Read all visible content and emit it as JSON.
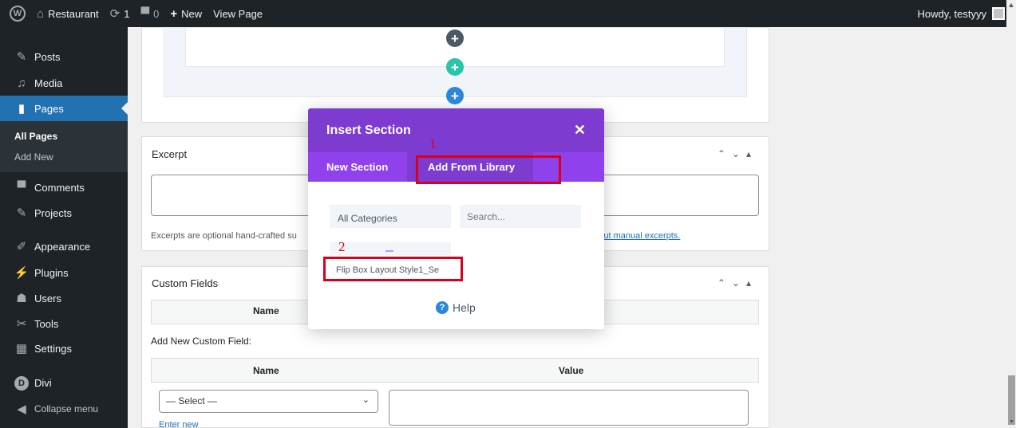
{
  "admin_bar": {
    "site_name": "Restaurant",
    "updates_count": "1",
    "comments_count": "0",
    "new_label": "New",
    "view_page_label": "View Page",
    "greeting": "Howdy, testyyy"
  },
  "sidebar": {
    "items": [
      {
        "label": "Posts",
        "icon": "pin-icon"
      },
      {
        "label": "Media",
        "icon": "media-icon"
      },
      {
        "label": "Pages",
        "icon": "pages-icon"
      },
      {
        "label": "Comments",
        "icon": "comment-icon"
      },
      {
        "label": "Projects",
        "icon": "pin-icon"
      },
      {
        "label": "Appearance",
        "icon": "brush-icon"
      },
      {
        "label": "Plugins",
        "icon": "plugin-icon"
      },
      {
        "label": "Users",
        "icon": "users-icon"
      },
      {
        "label": "Tools",
        "icon": "wrench-icon"
      },
      {
        "label": "Settings",
        "icon": "settings-icon"
      },
      {
        "label": "Divi",
        "icon": "divi-icon"
      },
      {
        "label": "Collapse menu",
        "icon": "collapse-icon"
      }
    ],
    "submenu": {
      "all_pages": "All Pages",
      "add_new": "Add New"
    }
  },
  "excerpt": {
    "title": "Excerpt",
    "help_text": "Excerpts are optional hand-crafted su",
    "link_text": "about manual excerpts."
  },
  "custom_fields": {
    "title": "Custom Fields",
    "name_header": "Name",
    "add_new_label": "Add New Custom Field:",
    "name_header_2": "Name",
    "value_header": "Value",
    "select_value": "— Select —",
    "enter_new": "Enter new"
  },
  "modal": {
    "title": "Insert Section",
    "tab_new_section": "New Section",
    "tab_add_from_library": "Add From Library",
    "category_select": "All Categories",
    "search_placeholder": "Search...",
    "library_item": "Flip Box Layout Style1_Se",
    "help_label": "Help"
  },
  "annotations": {
    "step1": "1",
    "step2": "2"
  },
  "colors": {
    "modal_header": "#7e3bd0",
    "modal_tabs": "#8f42ec",
    "wp_dark": "#1d2327",
    "wp_blue": "#2271b1",
    "annotation_red": "#d9001b",
    "plus_dark": "#4c5866",
    "plus_green": "#29c4a9",
    "plus_blue": "#2b87da"
  }
}
